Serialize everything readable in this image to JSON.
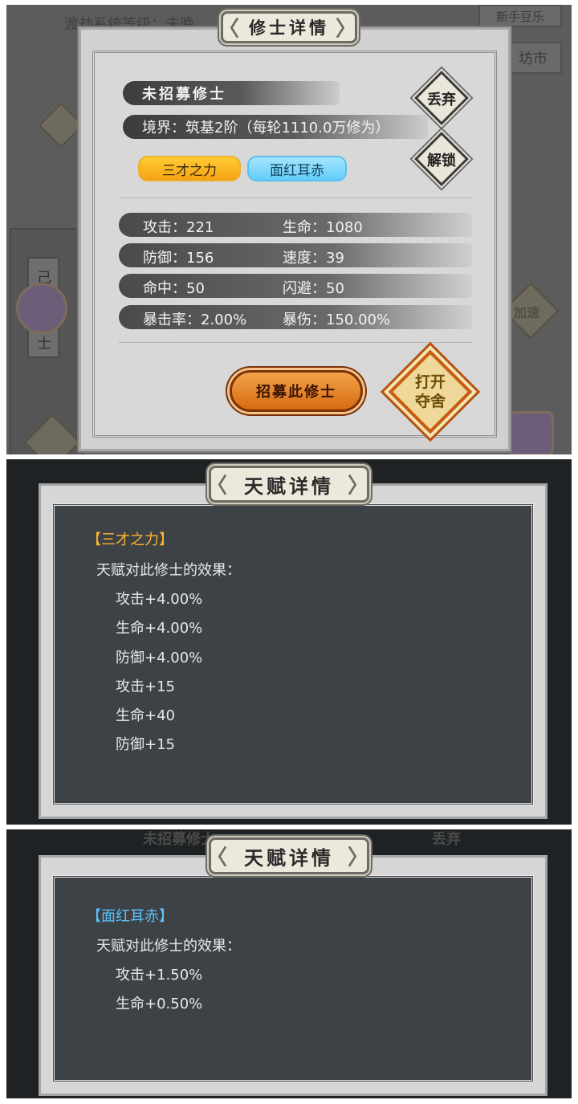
{
  "colors": {
    "talent_gold": "#ffb530",
    "talent_blue": "#5cc3ff",
    "recruit_orange": "#e07a1a"
  },
  "background": {
    "ghost_text_1": "渡劫系统等级：未晚",
    "ghost_text_2": "新手豆乐",
    "ghost_market": "坊市",
    "ghost_side_char_1": "己",
    "ghost_side_char_2": "士",
    "ghost_speed_btn": "加速",
    "ghost_under_title": "未招募修士",
    "ghost_under_discard": "丢弃"
  },
  "detail": {
    "title": "修士详情",
    "status": "未招募修士",
    "realm": "境界：筑基2阶（每轮1110.0万修为）",
    "discard_label": "丢弃",
    "unlock_label": "解锁",
    "talents": [
      "三才之力",
      "面红耳赤"
    ],
    "stats": [
      {
        "a": "攻击：221",
        "b": "生命：1080"
      },
      {
        "a": "防御：156",
        "b": "速度：39"
      },
      {
        "a": "命中：50",
        "b": "闪避：50"
      },
      {
        "a": "暴击率：2.00%",
        "b": "暴伤：150.00%"
      }
    ],
    "recruit_label": "招募此修士",
    "seize_label_line1": "打开",
    "seize_label_line2": "夺舍"
  },
  "talent1": {
    "title": "天赋详情",
    "name": "【三才之力】",
    "subtitle": "天赋对此修士的效果：",
    "effects": [
      "攻击+4.00%",
      "生命+4.00%",
      "防御+4.00%",
      "攻击+15",
      "生命+40",
      "防御+15"
    ]
  },
  "talent2": {
    "title": "天赋详情",
    "name": "【面红耳赤】",
    "subtitle": "天赋对此修士的效果：",
    "effects": [
      "攻击+1.50%",
      "生命+0.50%"
    ]
  }
}
